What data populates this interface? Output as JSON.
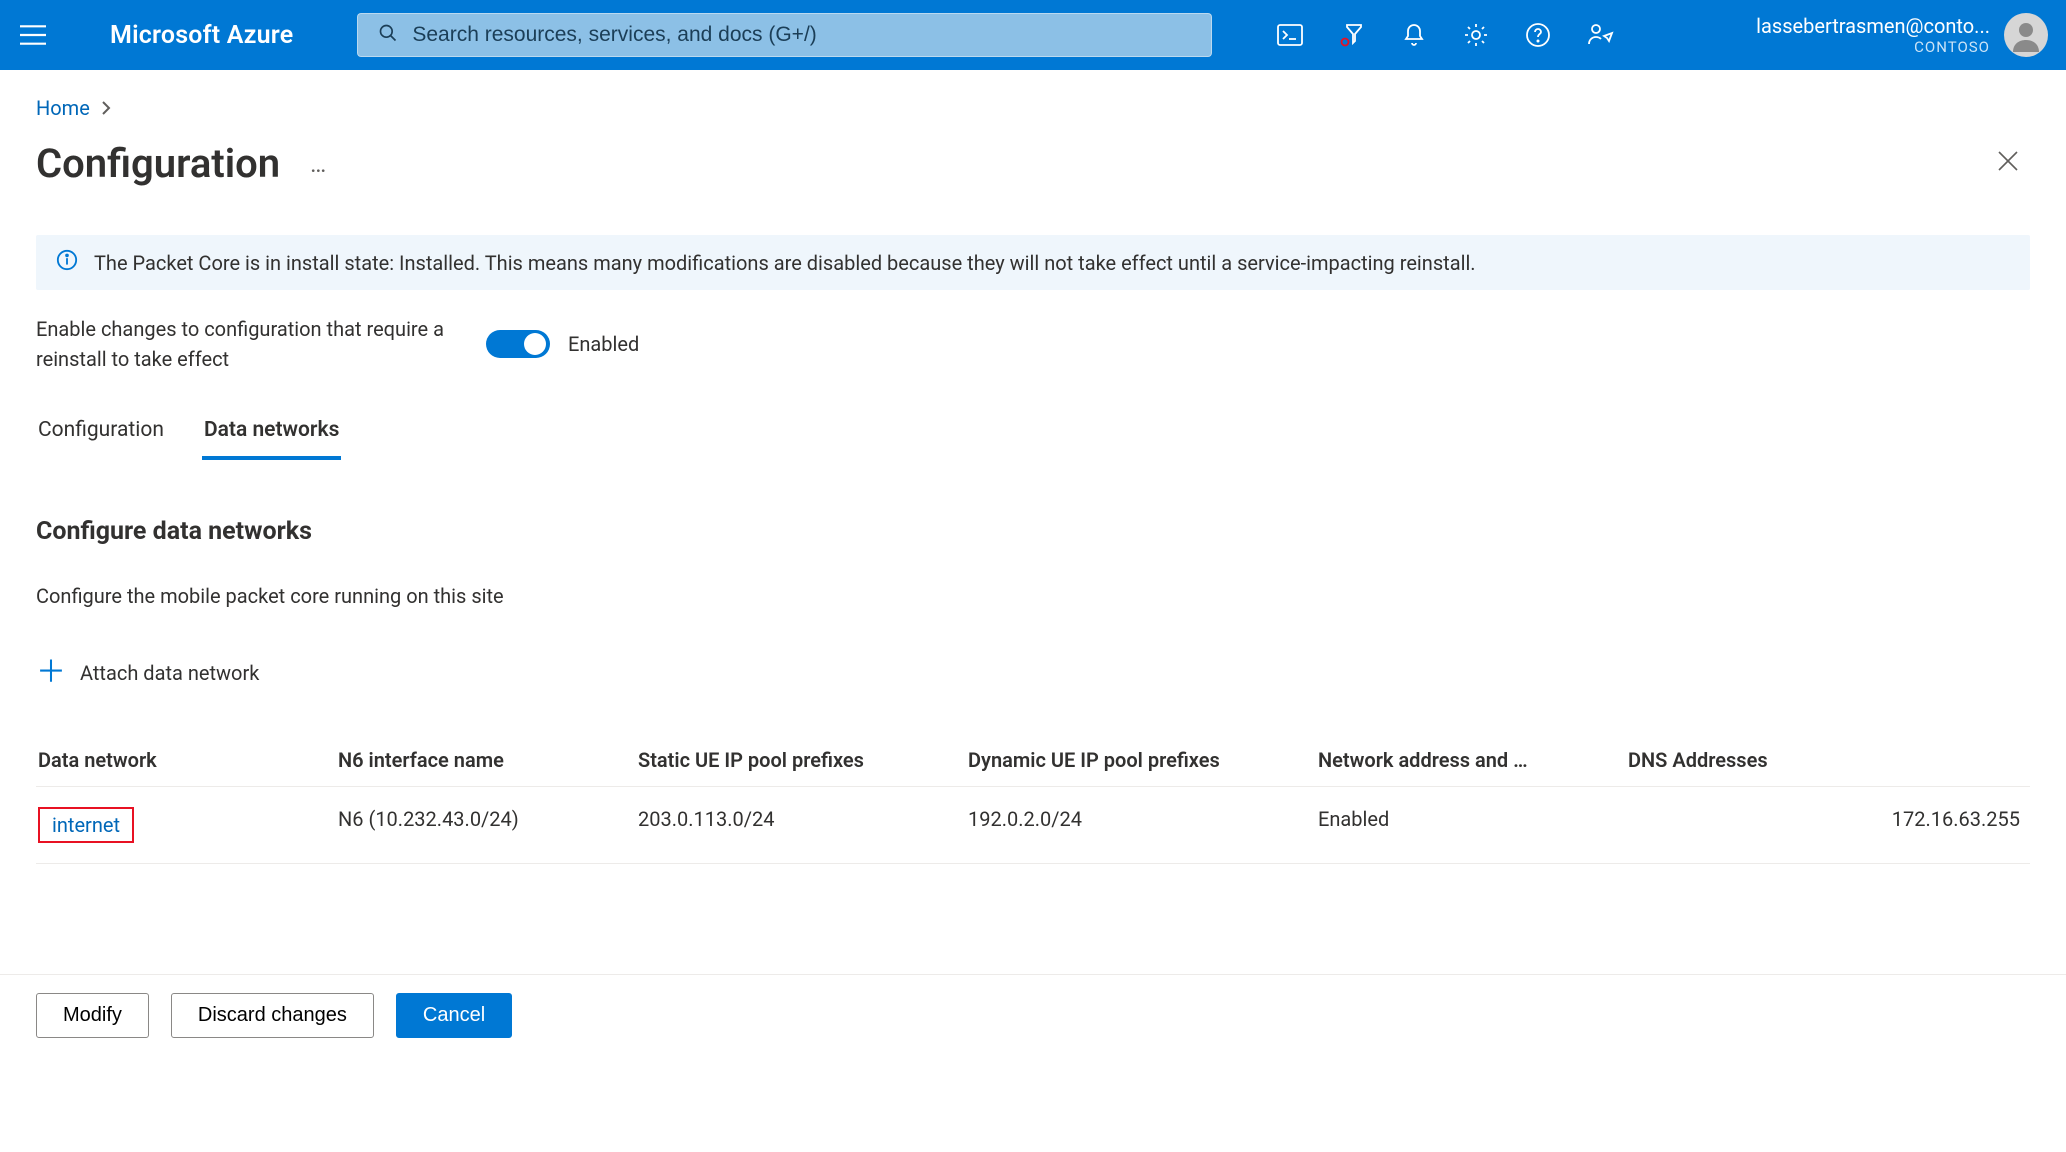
{
  "header": {
    "brand": "Microsoft Azure",
    "search_placeholder": "Search resources, services, and docs (G+/)",
    "account": {
      "email": "lassebertrasmen@conto...",
      "tenant": "CONTOSO"
    }
  },
  "breadcrumb": {
    "home": "Home"
  },
  "page": {
    "title": "Configuration",
    "info_message": "The Packet Core is in install state: Installed. This means many modifications are disabled because they will not take effect until a service-impacting reinstall.",
    "toggle_label": "Enable changes to configuration that require a reinstall to take effect",
    "toggle_state": "Enabled"
  },
  "tabs": {
    "configuration": "Configuration",
    "data_networks": "Data networks"
  },
  "section": {
    "title": "Configure data networks",
    "description": "Configure the mobile packet core running on this site",
    "attach_label": "Attach data network"
  },
  "table": {
    "headers": {
      "name": "Data network",
      "n6": "N6 interface name",
      "static": "Static UE IP pool prefixes",
      "dynamic": "Dynamic UE IP pool prefixes",
      "nat": "Network address and …",
      "dns": "DNS Addresses"
    },
    "row": {
      "name": "internet",
      "n6": "N6 (10.232.43.0/24)",
      "static": "203.0.113.0/24",
      "dynamic": "192.0.2.0/24",
      "nat": "Enabled",
      "dns": "172.16.63.255"
    }
  },
  "footer": {
    "modify": "Modify",
    "discard": "Discard changes",
    "cancel": "Cancel"
  }
}
